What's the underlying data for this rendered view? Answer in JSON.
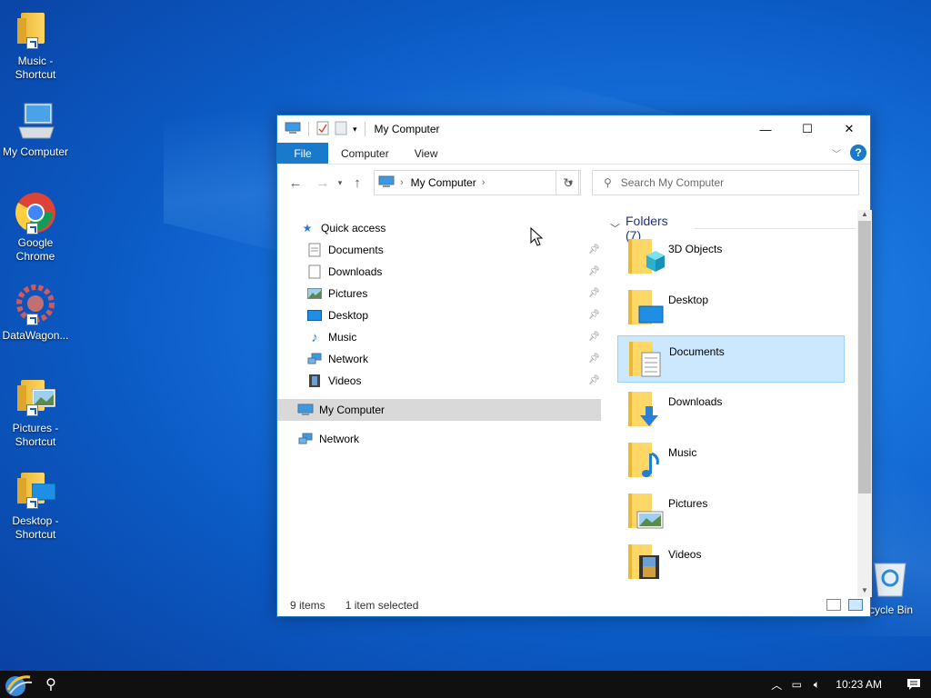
{
  "desktop": {
    "icons": [
      {
        "label": "Music - Shortcut"
      },
      {
        "label": "My Computer"
      },
      {
        "label": "Google Chrome"
      },
      {
        "label": "DataWagon..."
      },
      {
        "label": "Pictures - Shortcut"
      },
      {
        "label": "Desktop - Shortcut"
      },
      {
        "label": "cycle Bin"
      }
    ]
  },
  "window": {
    "title": "My Computer",
    "controls": {
      "minimize": "—",
      "maximize": "☐",
      "close": "✕"
    },
    "ribbon_tabs": [
      "File",
      "Computer",
      "View"
    ],
    "help": "?",
    "address": {
      "crumb": "My Computer",
      "separator": "›"
    },
    "search": {
      "placeholder": "Search My Computer"
    },
    "nav_pane": {
      "quick_access": "Quick access",
      "quick_items": [
        "Documents",
        "Downloads",
        "Pictures",
        "Desktop",
        "Music",
        "Network",
        "Videos"
      ],
      "my_computer": "My Computer",
      "network": "Network"
    },
    "content": {
      "group_header": "Folders (7)",
      "folders": [
        "3D Objects",
        "Desktop",
        "Documents",
        "Downloads",
        "Music",
        "Pictures",
        "Videos"
      ],
      "selected": "Documents"
    },
    "status": {
      "items": "9 items",
      "selected": "1 item selected"
    }
  },
  "taskbar": {
    "clock": "10:23 AM"
  },
  "colors": {
    "accent": "#1979ca",
    "selection": "#cce8ff",
    "desktop": "#0b5ac4"
  }
}
